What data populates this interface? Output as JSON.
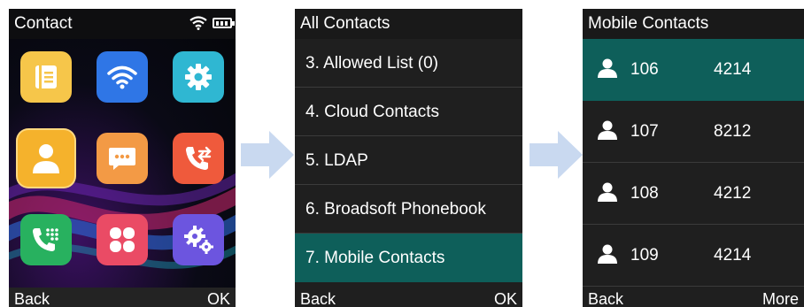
{
  "screen1": {
    "title": "Contact",
    "status_icons": [
      "wifi-icon",
      "battery-icon"
    ],
    "apps": [
      {
        "name": "directory",
        "icon": "directory-icon",
        "color": "#f6c64a"
      },
      {
        "name": "wifi",
        "icon": "wifi-icon",
        "color": "#2f76e6"
      },
      {
        "name": "settings",
        "icon": "gear-icon",
        "color": "#2fb7d2"
      },
      {
        "name": "contact",
        "icon": "person-icon",
        "color": "#f5b22c"
      },
      {
        "name": "message",
        "icon": "message-icon",
        "color": "#f39a45"
      },
      {
        "name": "call-transfer",
        "icon": "call-transfer-icon",
        "color": "#ef5a3c"
      },
      {
        "name": "dialpad",
        "icon": "phone-dialpad-icon",
        "color": "#28b15f"
      },
      {
        "name": "features",
        "icon": "clover-icon",
        "color": "#ea4b65"
      },
      {
        "name": "advanced",
        "icon": "gears-icon",
        "color": "#6c55df"
      }
    ],
    "softkeys": {
      "left": "Back",
      "right": "OK"
    }
  },
  "screen2": {
    "title": "All Contacts",
    "items": [
      {
        "label": "3. Allowed List (0)",
        "selected": false
      },
      {
        "label": "4. Cloud Contacts",
        "selected": false
      },
      {
        "label": "5. LDAP",
        "selected": false
      },
      {
        "label": "6. Broadsoft Phonebook",
        "selected": false
      },
      {
        "label": "7. Mobile Contacts",
        "selected": true
      }
    ],
    "softkeys": {
      "left": "Back",
      "right": "OK"
    }
  },
  "screen3": {
    "title": "Mobile Contacts",
    "contacts": [
      {
        "name": "106",
        "number": "4214",
        "selected": true
      },
      {
        "name": "107",
        "number": "8212",
        "selected": false
      },
      {
        "name": "108",
        "number": "4212",
        "selected": false
      },
      {
        "name": "109",
        "number": "4214",
        "selected": false
      }
    ],
    "softkeys": {
      "left": "Back",
      "right": "More"
    }
  },
  "colors": {
    "highlight": "#0e5f5a",
    "arrow": "#c9d9f0"
  }
}
